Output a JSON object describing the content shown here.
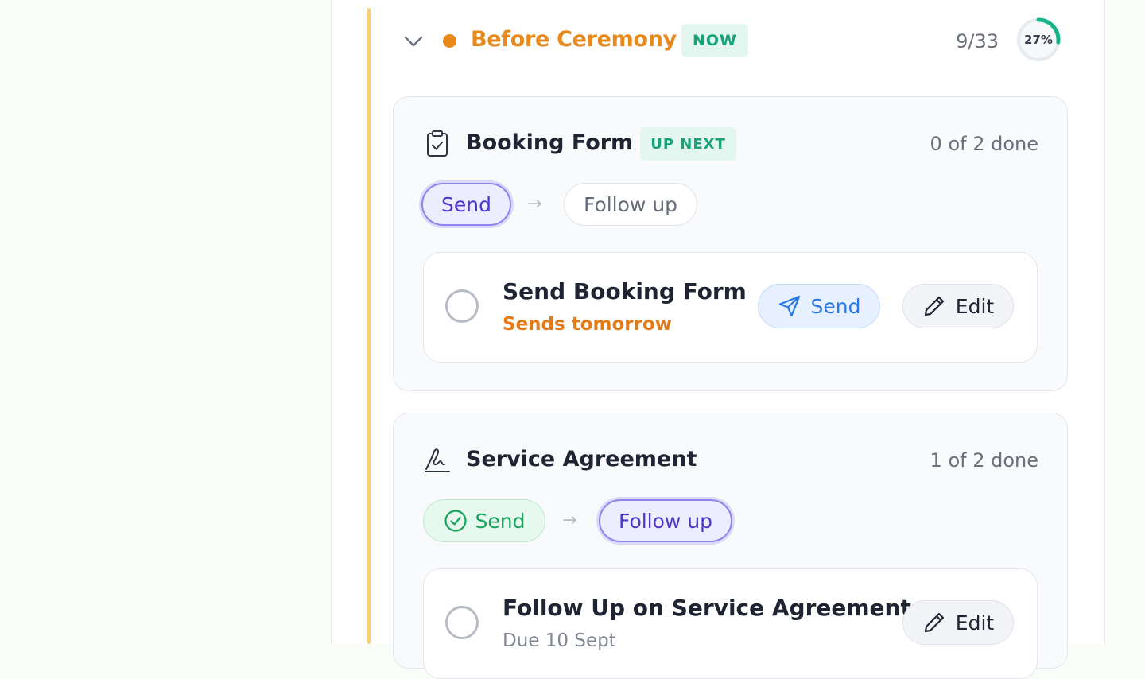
{
  "phase": {
    "title": "Before Ceremony",
    "badge": "NOW",
    "count": "9/33",
    "progress_label": "27%",
    "progress_fraction": 0.27,
    "colors": {
      "accent": "#e8891c",
      "badge_bg": "#e3f6ef",
      "badge_text": "#17a27a",
      "ring": "#18b38a",
      "timeline": "#f6cf72"
    }
  },
  "sections": [
    {
      "title": "Booking Form",
      "icon": "clipboard-check-icon",
      "badge": "UP NEXT",
      "count": "0 of 2 done",
      "steps": [
        {
          "label": "Send",
          "state": "active"
        },
        {
          "label": "Follow up",
          "state": "pending"
        }
      ],
      "task": {
        "title": "Send Booking Form",
        "subtitle": "Sends tomorrow",
        "send_label": "Send",
        "edit_label": "Edit"
      }
    },
    {
      "title": "Service Agreement",
      "icon": "signature-icon",
      "count": "1 of 2 done",
      "steps": [
        {
          "label": "Send",
          "state": "done"
        },
        {
          "label": "Follow up",
          "state": "active"
        }
      ],
      "task": {
        "title": "Follow Up on Service Agreement",
        "subtitle": "Due 10 Sept",
        "edit_label": "Edit"
      }
    }
  ],
  "arrow_glyph": "→"
}
